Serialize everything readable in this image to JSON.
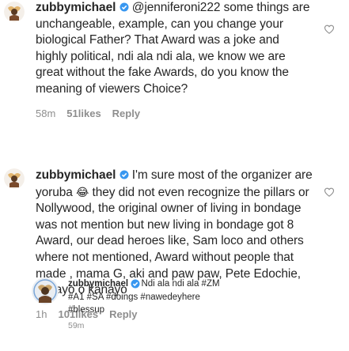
{
  "comments": [
    {
      "username": "zubbymichael",
      "mention": "@jenniferoni222",
      "text": "some things are unchangeable, example, can you change your biological Father? That Award was a joke and highly political, ndi ala ndi ala, we know we are great without the fake Awards, do you know the meaning of viewers Choice?",
      "time": "58m",
      "likes": "51likes",
      "reply": "Reply"
    },
    {
      "username": "zubbymichael",
      "text_before_emoji": "I'm sure most of the organizer are yoruba",
      "emoji": "😂",
      "text_after_emoji": "they did not even recognize the pillars or Nollywood, the original owner of living in bondage was not mention  but new living in bondage got 8 Award, our dead heroes like,  Sam loco and others where not mentioned, Award without people that made , mama G, aki and paw paw, Pete Edochie, kanayo o kanayo",
      "time": "1h",
      "likes": "101likes",
      "reply": "Reply"
    },
    {
      "username": "zubbymichael",
      "text_line1": "Ndi ala ndi ala #ZM",
      "text_line2": "#A1 #SA #doings #nawedeyhere",
      "text_line3": "#blessup",
      "time": "59m"
    }
  ],
  "icons": {
    "like": "heart-outline-icon",
    "verified": "verified-badge-icon"
  },
  "colors": {
    "text": "#262626",
    "muted": "#8e8e8e",
    "verified": "#3897f0"
  }
}
